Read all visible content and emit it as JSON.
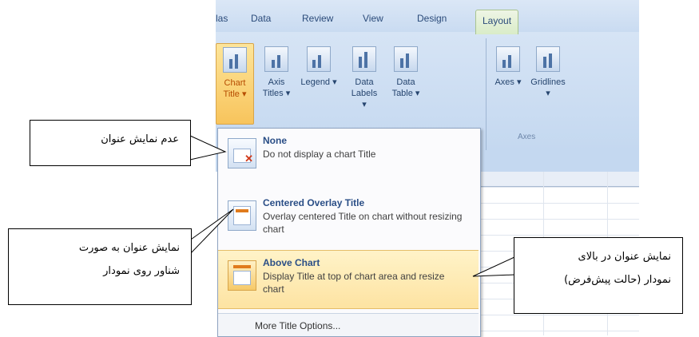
{
  "ribbon": {
    "tabs": [
      "las",
      "Data",
      "Review",
      "View",
      "Design",
      "Layout"
    ],
    "active_tab": "Layout",
    "buttons": [
      {
        "label": "Chart Title ▾"
      },
      {
        "label": "Axis Titles ▾"
      },
      {
        "label": "Legend ▾"
      },
      {
        "label": "Data Labels ▾"
      },
      {
        "label": "Data Table ▾"
      },
      {
        "label": "Axes ▾"
      },
      {
        "label": "Gridlines ▾"
      }
    ],
    "group_label": "Axes"
  },
  "dropdown": {
    "options": [
      {
        "title": "None",
        "description": "Do not display a chart Title"
      },
      {
        "title": "Centered Overlay Title",
        "description": "Overlay centered Title on chart without resizing chart"
      },
      {
        "title": "Above Chart",
        "description": "Display Title at top of chart area and resize chart"
      }
    ],
    "more": "More Title Options..."
  },
  "callouts": {
    "none": "عدم نمایش عنوان",
    "overlay_line1": "نمایش عنوان به صورت",
    "overlay_line2": "شناور روی نمودار",
    "above_line1": "نمایش عنوان در بالای",
    "above_line2": "نمودار (حالت پیش‌فرض)"
  },
  "colors": {
    "selected": "#f8c45c",
    "accent_text": "#2a4e86"
  }
}
